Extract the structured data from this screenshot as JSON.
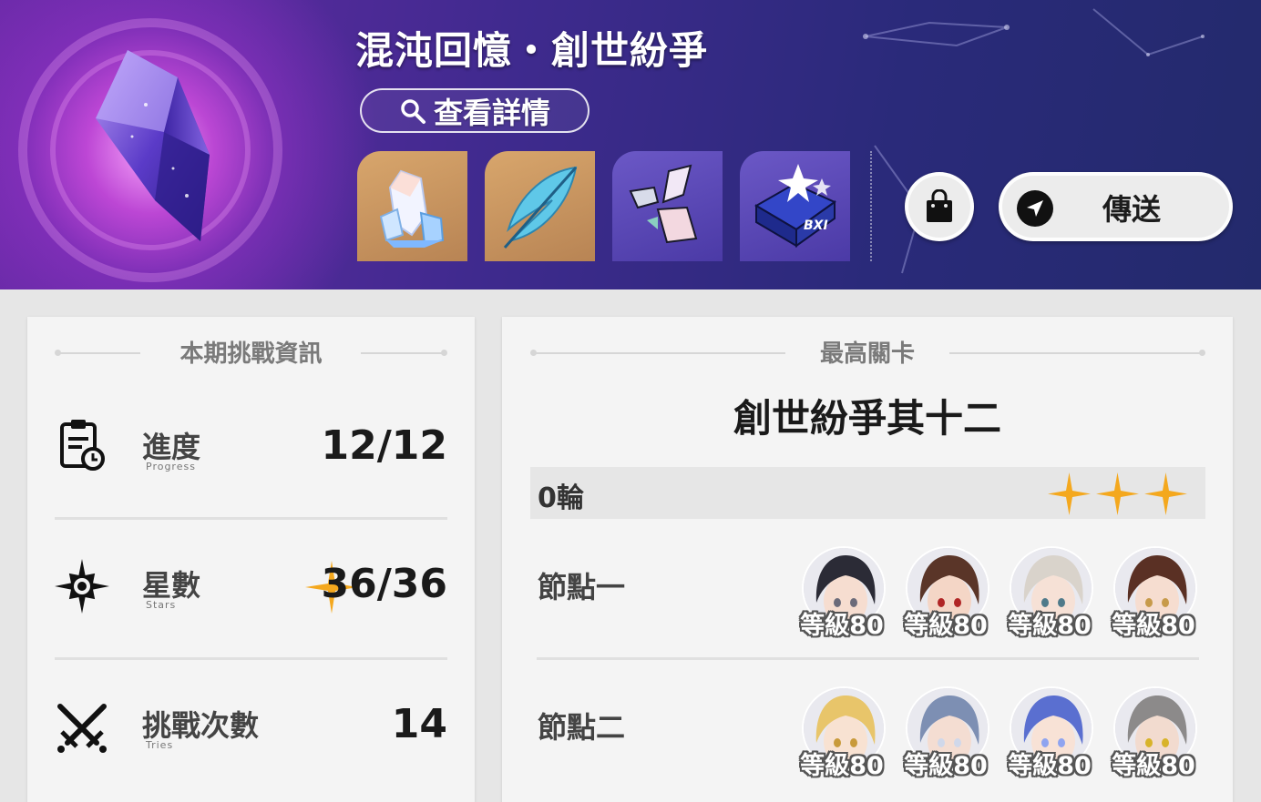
{
  "banner": {
    "title": "混沌回憶・創世紛爭",
    "details_label": "查看詳情",
    "teleport_label": "傳送",
    "rewards": [
      {
        "icon": "crystal-reward-icon"
      },
      {
        "icon": "feather-reward-icon"
      },
      {
        "icon": "shards-reward-icon"
      },
      {
        "icon": "book-reward-icon"
      }
    ]
  },
  "info_card": {
    "header": "本期挑戰資訊",
    "progress": {
      "label": "進度",
      "sub": "Progress",
      "value": "12/12"
    },
    "stars": {
      "label": "星數",
      "sub": "Stars",
      "value": "36/36"
    },
    "attempts": {
      "label": "挑戰次數",
      "sub": "Tries",
      "value": "14"
    }
  },
  "stage_card": {
    "header": "最高關卡",
    "stage_name": "創世紛爭其十二",
    "round_label": "0輪",
    "stars_earned": 3,
    "nodes": [
      {
        "label": "節點一",
        "characters": [
          {
            "level": "等級80",
            "hair": "#2b2b36",
            "skin": "#f6ddd0",
            "accent": "#6b6b7a"
          },
          {
            "level": "等級80",
            "hair": "#5a3528",
            "skin": "#f4d6c6",
            "accent": "#b02525"
          },
          {
            "level": "等級80",
            "hair": "#d9d3cb",
            "skin": "#f6e1d6",
            "accent": "#4f7a8a"
          },
          {
            "level": "等級80",
            "hair": "#5a3024",
            "skin": "#f6ddd0",
            "accent": "#c79a4a"
          }
        ]
      },
      {
        "label": "節點二",
        "characters": [
          {
            "level": "等級80",
            "hair": "#e8c56a",
            "skin": "#f8e2d2",
            "accent": "#c89a3a"
          },
          {
            "level": "等級80",
            "hair": "#7d8fb3",
            "skin": "#f4ddd2",
            "accent": "#d0d8ea"
          },
          {
            "level": "等級80",
            "hair": "#5a6fd0",
            "skin": "#f8e2d6",
            "accent": "#8fa4f0"
          },
          {
            "level": "等級80",
            "hair": "#8c8a8a",
            "skin": "#f2dbcf",
            "accent": "#d8b32a"
          }
        ]
      }
    ]
  },
  "colors": {
    "star": "#f4a81e",
    "banner_purple": "#4a2c96",
    "card_bg": "#f4f4f4"
  }
}
